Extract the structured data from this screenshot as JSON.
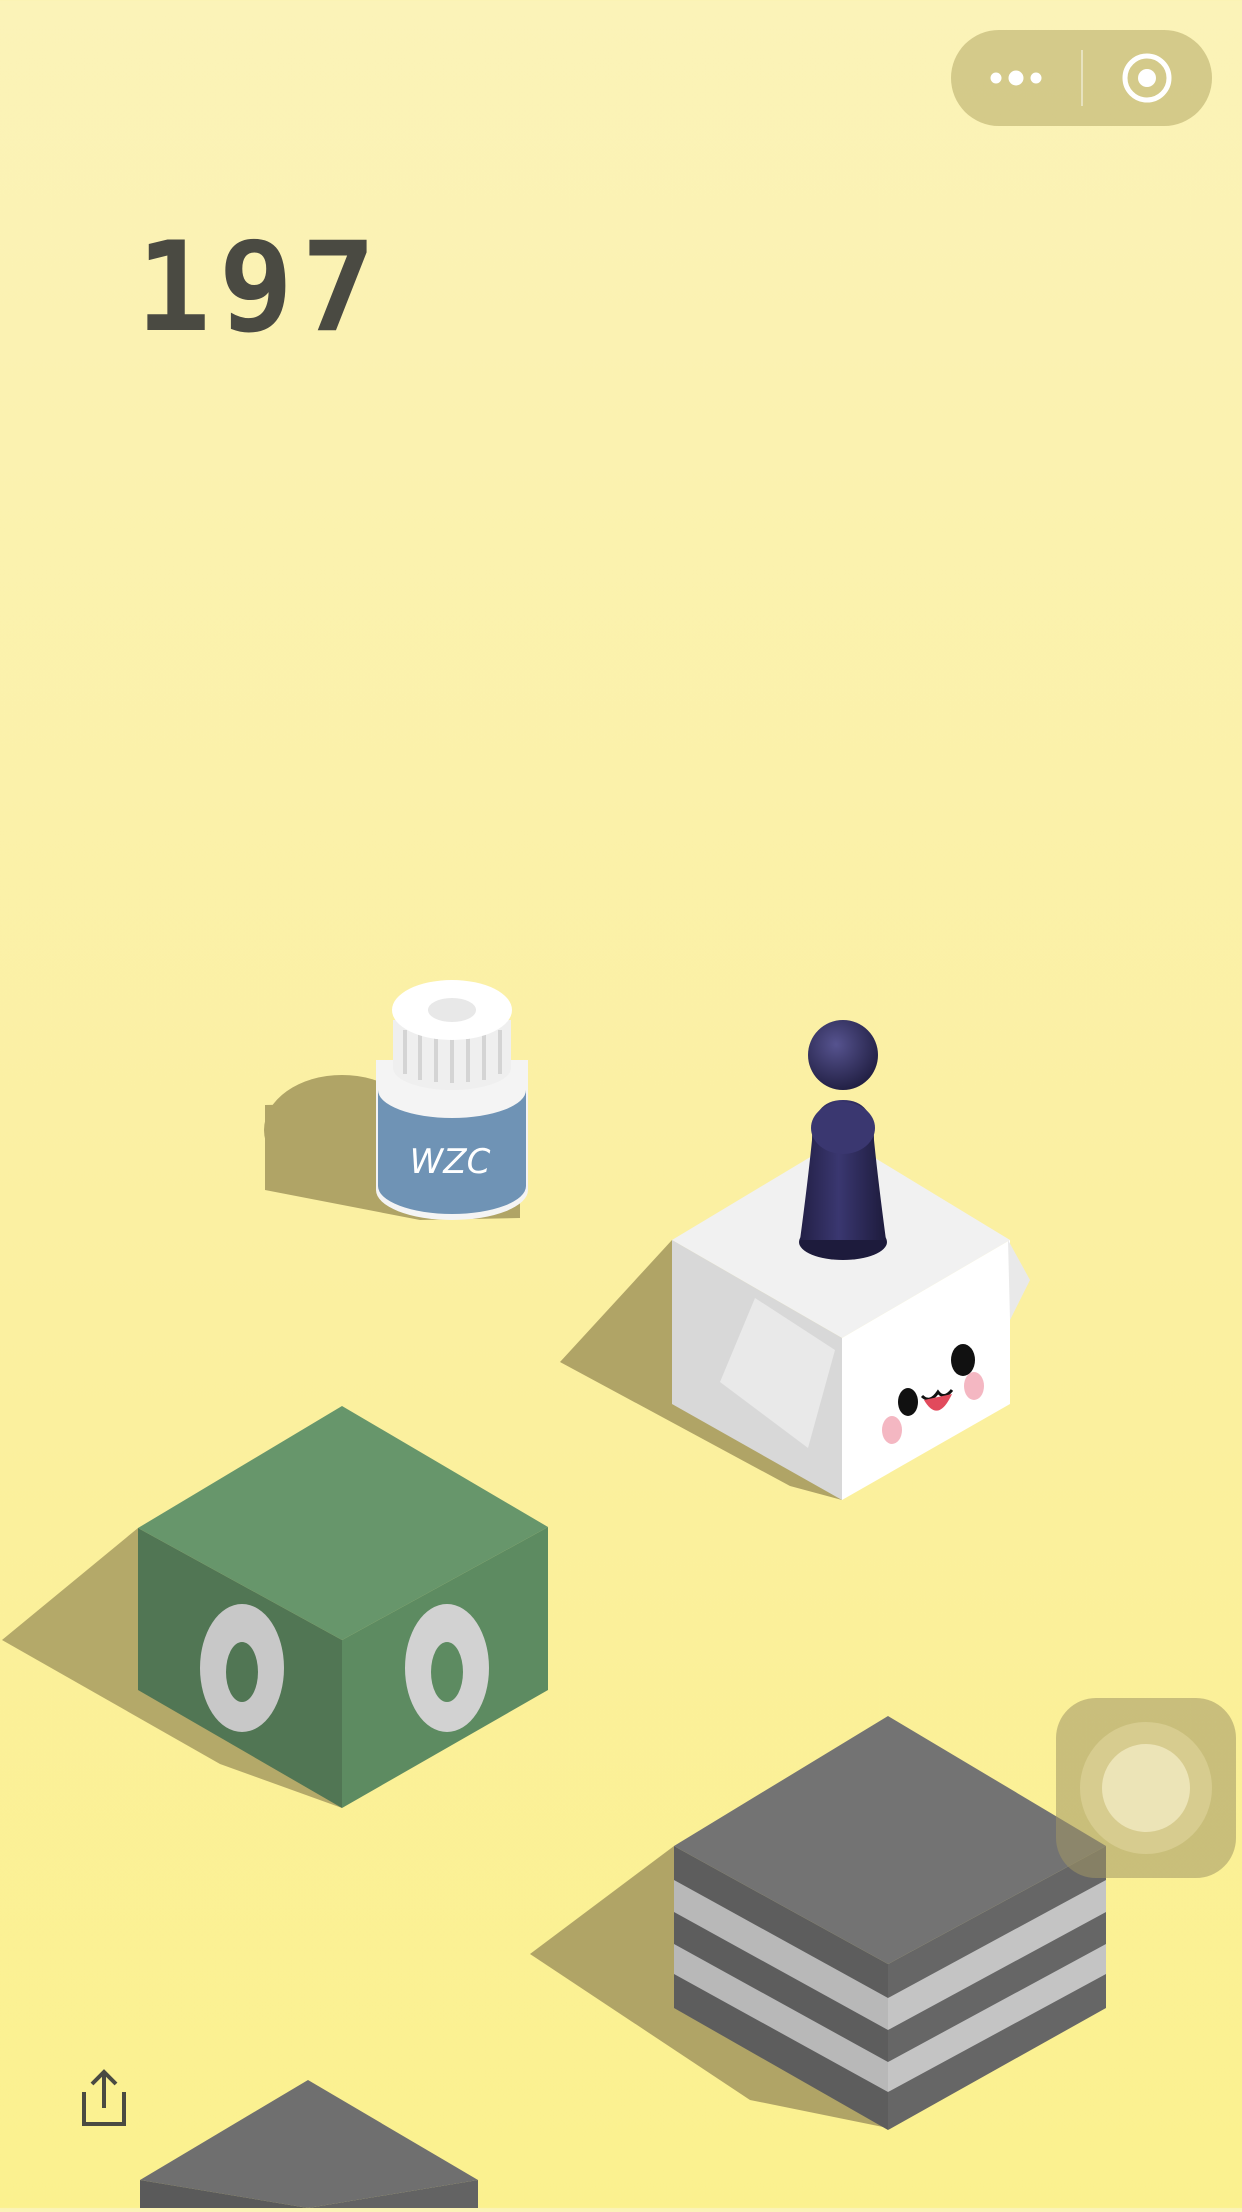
{
  "game": {
    "score": "197",
    "bottle_label": "WZC"
  },
  "capsule": {
    "more_icon": "more-dots-icon",
    "close_icon": "target-circle-icon"
  },
  "share_icon": "share-icon",
  "floating_button_icon": "assistive-touch-icon",
  "colors": {
    "background_top": "#fbf3b8",
    "background_bottom": "#fbf18f",
    "score": "#4a4a42",
    "piece": "#2f2d5a",
    "green_block_top": "#67966b",
    "gray_block_top": "#737373",
    "bottle_label_band": "#6f93b5"
  }
}
